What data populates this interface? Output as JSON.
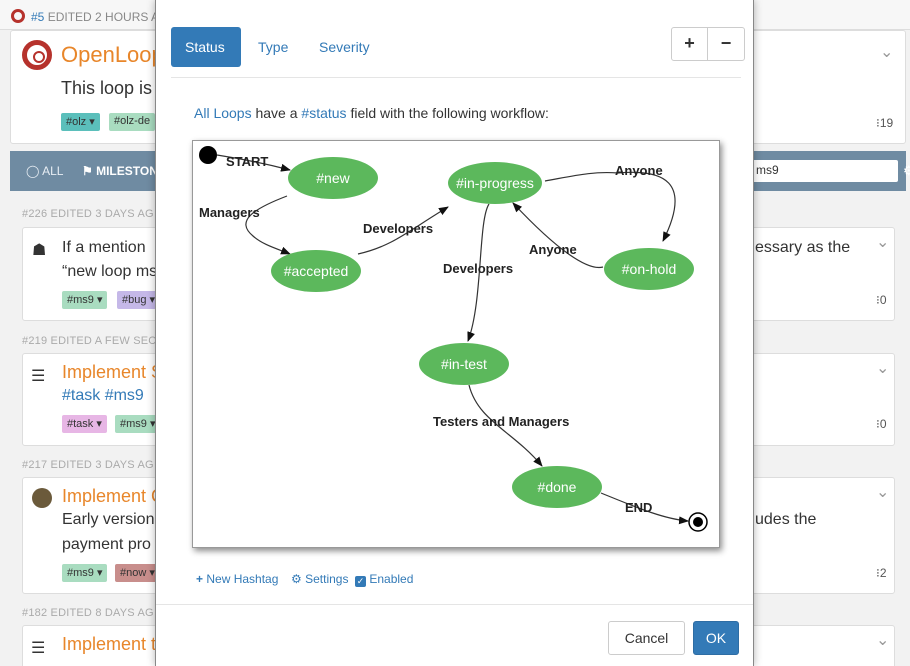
{
  "topbar": {
    "number": "#5",
    "edited": "EDITED 2 HOURS A"
  },
  "main": {
    "title": "OpenLoop",
    "subtitle": "This loop is",
    "tags": [
      "#olz",
      "#olz-de"
    ],
    "count": "19"
  },
  "filter": {
    "all": "ALL",
    "milestone": "MILESTONE",
    "search_value": "ms9"
  },
  "items": [
    {
      "meta": "#226 EDITED 3 DAYS AG",
      "line1": "If a mention",
      "line1_right": "essary as the",
      "line2": "“new loop ms",
      "tags": [
        "#ms9",
        "#bug"
      ],
      "count": "0"
    },
    {
      "meta": "#219 EDITED A FEW SEC",
      "line1": "Implement S",
      "line2": "#task #ms9",
      "tags": [
        "#task",
        "#ms9"
      ],
      "count": "0"
    },
    {
      "meta": "#217 EDITED 3 DAYS AG",
      "line1": "Implement C",
      "line2": "Early version",
      "line2_right": "udes the",
      "line3": "payment pro",
      "tags": [
        "#ms9",
        "#now"
      ],
      "count": "2"
    },
    {
      "meta": "#182 EDITED 8 DAYS AG",
      "line1": "Implement t"
    }
  ],
  "modal": {
    "tabs": [
      {
        "label": "Status",
        "active": true
      },
      {
        "label": "Type",
        "active": false
      },
      {
        "label": "Severity",
        "active": false
      }
    ],
    "zoom_in": "+",
    "zoom_out": "−",
    "desc_link1": "All Loops",
    "desc_mid": " have a ",
    "desc_link2": "#status",
    "desc_end": " field with the following workflow:",
    "new_hashtag": "New Hashtag",
    "settings": "Settings",
    "enabled": "Enabled",
    "cancel": "Cancel",
    "ok": "OK"
  },
  "diagram": {
    "node_color": "#5cb85c",
    "nodes": {
      "new": "#new",
      "accepted": "#accepted",
      "in_progress": "#in-progress",
      "on_hold": "#on-hold",
      "in_test": "#in-test",
      "done": "#done"
    },
    "edges": {
      "start": "START",
      "managers": "Managers",
      "developers1": "Developers",
      "developers2": "Developers",
      "anyone1": "Anyone",
      "anyone2": "Anyone",
      "testers": "Testers and Managers",
      "end": "END"
    }
  }
}
